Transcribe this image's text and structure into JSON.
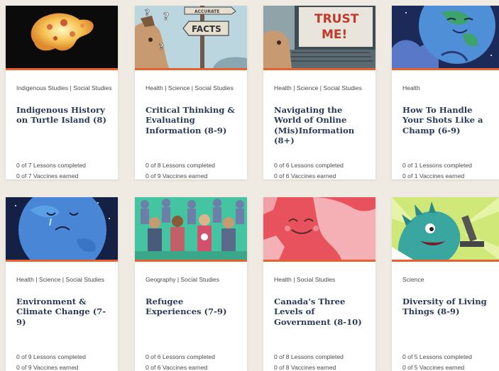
{
  "cards": [
    {
      "subjects": "Indigenous Studies | Social Studies",
      "title": "Indigenous History on Turtle Island (8)",
      "lessons": "0 of 7 Lessons completed",
      "vaccines": "0 of 7 Vaccines earned",
      "thumb_icon": "turtle-island-icon"
    },
    {
      "subjects": "Health | Science | Social Studies",
      "title": "Critical Thinking & Evaluating Information (8-9)",
      "lessons": "0 of 8 Lessons completed",
      "vaccines": "0 of 9 Vaccines earned",
      "thumb_icon": "facts-signpost-icon",
      "thumb_sign_top": "ACCURATE",
      "thumb_sign": "FACTS"
    },
    {
      "subjects": "Health | Science | Social Studies",
      "title": "Navigating the World of Online (Mis)Information (8+)",
      "lessons": "0 of 6 Lessons completed",
      "vaccines": "0 of 6 Vaccines earned",
      "thumb_icon": "laptop-trust-me-icon",
      "thumb_text_1": "TRUST",
      "thumb_text_2": "ME!"
    },
    {
      "subjects": "Health",
      "title": "How To Handle Your Shots Like a Champ (6-9)",
      "lessons": "0 of 1 Lessons completed",
      "vaccines": "0 of 1 Vaccines earned",
      "thumb_icon": "happy-earth-icon"
    },
    {
      "subjects": "Health | Science | Social Studies",
      "title": "Environment & Climate Change (7-9)",
      "lessons": "0 of 9 Lessons completed",
      "vaccines": "0 of 9 Vaccines earned",
      "thumb_icon": "crying-earth-icon"
    },
    {
      "subjects": "Geography | Social Studies",
      "title": "Refugee Experiences (7-9)",
      "lessons": "0 of 6 Lessons completed",
      "vaccines": "0 of 6 Vaccines earned",
      "thumb_icon": "crowd-of-people-icon"
    },
    {
      "subjects": "Health | Social Studies",
      "title": "Canada's Three Levels of Government (8-10)",
      "lessons": "0 of 8 Lessons completed",
      "vaccines": "0 of 8 Vaccines earned",
      "thumb_icon": "smiling-map-icon"
    },
    {
      "subjects": "Science",
      "title": "Diversity of Living Things (8-9)",
      "lessons": "0 of 5 Lessons completed",
      "vaccines": "0 of 5 Vaccines earned",
      "thumb_icon": "microscope-creature-icon"
    }
  ],
  "colors": {
    "background": "#efebe3",
    "accent": "#e8612c",
    "title": "#2b3a57"
  }
}
